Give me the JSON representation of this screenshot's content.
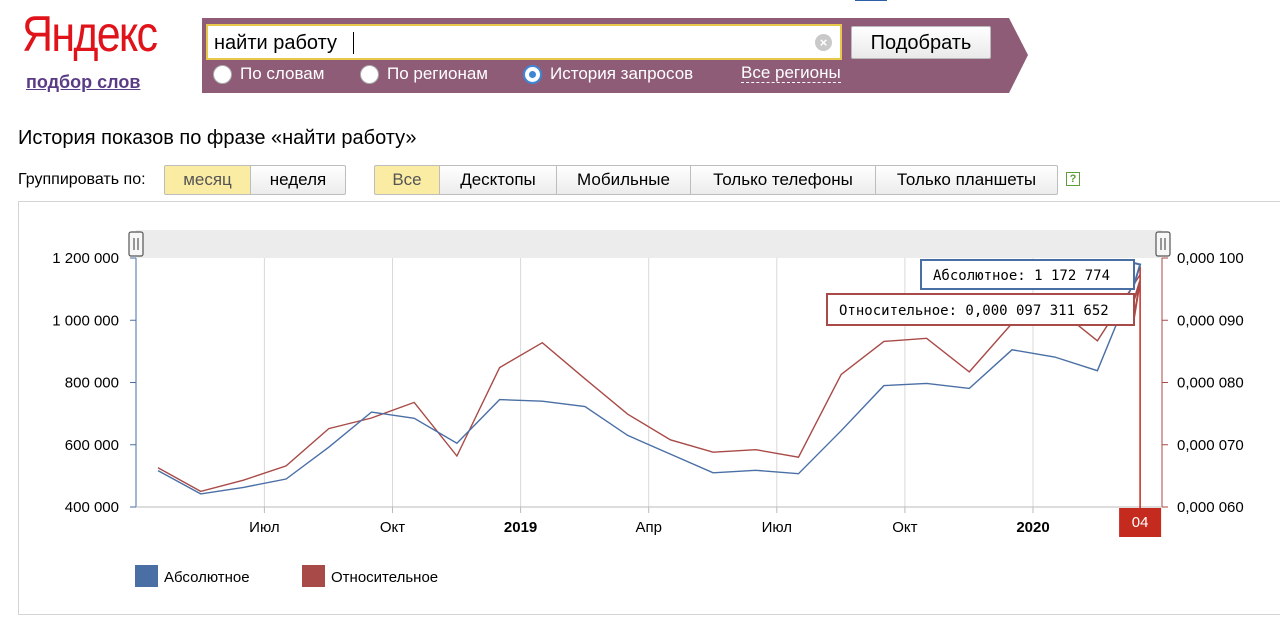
{
  "header": {
    "logo_text": "Яндекс",
    "logo_subtitle": "подбор слов",
    "search_value": "найти работу",
    "clear_icon": "×",
    "submit_label": "Подобрать",
    "radios": [
      {
        "label": "По словам",
        "selected": false
      },
      {
        "label": "По регионам",
        "selected": false
      },
      {
        "label": "История запросов",
        "selected": true
      }
    ],
    "regions_link": "Все регионы"
  },
  "page_title": "История показов по фразе «найти работу»",
  "controls": {
    "group_label": "Группировать по:",
    "group_options": [
      {
        "label": "месяц",
        "active": true
      },
      {
        "label": "неделя",
        "active": false
      }
    ],
    "device_options": [
      {
        "label": "Все",
        "active": true
      },
      {
        "label": "Десктопы",
        "active": false
      },
      {
        "label": "Мобильные",
        "active": false
      },
      {
        "label": "Только телефоны",
        "active": false
      },
      {
        "label": "Только планшеты",
        "active": false
      }
    ],
    "help_icon": "?"
  },
  "colors": {
    "absolute": "#4a6fa5",
    "relative": "#a84a47",
    "marker": "#c42a1d",
    "panel": "#8f5c78",
    "logo": "#e0131a"
  },
  "chart_data": {
    "type": "line",
    "x": [
      "2018-05",
      "2018-06",
      "2018-07",
      "2018-08",
      "2018-09",
      "2018-10",
      "2018-11",
      "2018-12",
      "2019-01",
      "2019-02",
      "2019-03",
      "2019-04",
      "2019-05",
      "2019-06",
      "2019-07",
      "2019-08",
      "2019-09",
      "2019-10",
      "2019-11",
      "2019-12",
      "2020-01",
      "2020-02",
      "2020-03",
      "2020-04"
    ],
    "x_ticks": [
      {
        "at": "2018-07",
        "label": "Июл",
        "bold": false
      },
      {
        "at": "2018-10",
        "label": "Окт",
        "bold": false
      },
      {
        "at": "2019-01",
        "label": "2019",
        "bold": true
      },
      {
        "at": "2019-04",
        "label": "Апр",
        "bold": false
      },
      {
        "at": "2019-07",
        "label": "Июл",
        "bold": false
      },
      {
        "at": "2019-10",
        "label": "Окт",
        "bold": false
      },
      {
        "at": "2020-01",
        "label": "2020",
        "bold": true
      }
    ],
    "series": [
      {
        "name": "Абсолютное",
        "axis": "left",
        "values": [
          517000,
          442000,
          463000,
          490000,
          592000,
          705000,
          685000,
          605000,
          745000,
          740000,
          723000,
          630000,
          570000,
          510000,
          518000,
          507000,
          645000,
          790000,
          797000,
          781000,
          905000,
          882000,
          838000,
          1172774
        ]
      },
      {
        "name": "Относительное",
        "axis": "right",
        "values": [
          6.63e-05,
          6.25e-05,
          6.43e-05,
          6.66e-05,
          7.26e-05,
          7.43e-05,
          7.68e-05,
          6.82e-05,
          8.24e-05,
          8.64e-05,
          8.06e-05,
          7.49e-05,
          7.08e-05,
          6.88e-05,
          6.92e-05,
          6.8e-05,
          8.13e-05,
          8.66e-05,
          8.71e-05,
          8.17e-05,
          8.95e-05,
          9.22e-05,
          8.67e-05,
          9.73e-05
        ]
      }
    ],
    "y_left": {
      "ticks": [
        400000,
        600000,
        800000,
        1000000,
        1200000
      ],
      "labels": [
        "400 000",
        "600 000",
        "800 000",
        "1 000 000",
        "1 200 000"
      ],
      "range": [
        400000,
        1200000
      ]
    },
    "y_right": {
      "ticks": [
        6e-05,
        7e-05,
        8e-05,
        9e-05,
        0.0001
      ],
      "labels": [
        "0,000 060",
        "0,000 070",
        "0,000 080",
        "0,000 090",
        "0,000 100"
      ],
      "range": [
        6e-05,
        0.0001
      ]
    },
    "tooltips": {
      "absolute": "Абсолютное: 1 172 774",
      "relative": "Относительное: 0,000 097 311 652"
    },
    "marker_label": "04",
    "legend": [
      "Абсолютное",
      "Относительное"
    ],
    "legend_position": "bottom-left",
    "grid": true
  }
}
